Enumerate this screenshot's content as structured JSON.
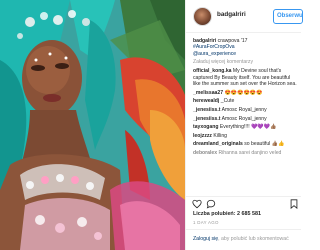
{
  "post": {
    "username": "badgalriri",
    "follow_label": "Obserwuj",
    "caption": {
      "username": "badgalriri",
      "text": "crawpova '17",
      "hashtag": "#AuraForCropOva",
      "mention": "@aura_experience"
    },
    "load_more": "Załaduj więcej komentarzy",
    "comments": [
      {
        "user": "official_kong.ka",
        "text": "My Devine soul that's captured By Beauty itself. You are beautiful like the summer sun set over the Horizon sea."
      },
      {
        "user": "_melissaa27",
        "text": "😍😍😍😍😍😍"
      },
      {
        "user": "herewealdj",
        "text": "_Cute"
      },
      {
        "user": "_jenesiiss.t",
        "text": "Amosc Royal_jenny"
      },
      {
        "user": "_jenesiiss.t",
        "text": "Amosc Royal_jenny"
      },
      {
        "user": "tayxogang",
        "text": "Everything!!!! 💜💜💜👍🏽"
      },
      {
        "user": "leojzzzz",
        "text": "Killing"
      },
      {
        "user": "dreamland_originals",
        "text": "so beautiful 👍🏽👍"
      },
      {
        "user": "deboralex",
        "text": "Rihanna sarei danjino veled"
      }
    ],
    "likes": "Liczba polubień: 2 685 581",
    "date": "1 DAY AGO",
    "login_link": "Zaloguj się",
    "login_text": ", aby polubić lub skomentować"
  },
  "icons": {
    "like": "heart-icon",
    "comment": "comment-icon",
    "save": "bookmark-icon"
  },
  "colors": {
    "accent": "#3897f0",
    "link": "#003569",
    "muted": "#999999",
    "text": "#262626",
    "divider": "#efefef"
  }
}
